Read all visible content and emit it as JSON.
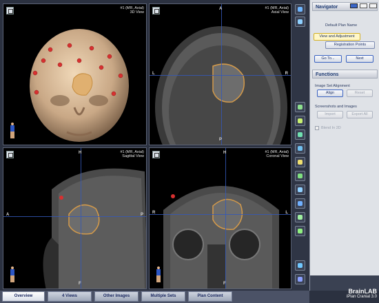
{
  "viewports": {
    "tl": {
      "series": "#1 (MR, Axial)",
      "view": "3D View"
    },
    "tr": {
      "series": "#1 (MR, Axial)",
      "view": "Axial View",
      "top": "A",
      "left": "L",
      "right": "R",
      "bottom": "P"
    },
    "bl": {
      "series": "#1 (MR, Axial)",
      "view": "Sagittal View",
      "top": "H",
      "left": "A",
      "right": "P",
      "bottom": "F"
    },
    "br": {
      "series": "#1 (MR, Axial)",
      "view": "Coronal View",
      "top": "H",
      "left": "R",
      "right": "L",
      "bottom": "F"
    }
  },
  "navigator": {
    "title": "Navigator",
    "plan_name": "Default Plan Name",
    "step_active": "View and Adjustment",
    "step_next": "Registration Points",
    "goto": "Go To...",
    "next": "Next"
  },
  "functions": {
    "title": "Functions",
    "image_set_alignment": "Image Set Alignment",
    "align": "Align",
    "reset": "Reset",
    "screenshots": "Screenshots and Images",
    "import": "Import",
    "export_all": "Export All",
    "blend": "Blend In 2D"
  },
  "tabs": [
    "Overview",
    "4 Views",
    "Other Images",
    "Multiple Sets",
    "Plan Content"
  ],
  "brand": {
    "name": "BrainLAB",
    "product": "iPlan Cranial 3.0"
  },
  "colors": {
    "accent": "#3458b8",
    "tumor_outline": "#d49a4a"
  }
}
